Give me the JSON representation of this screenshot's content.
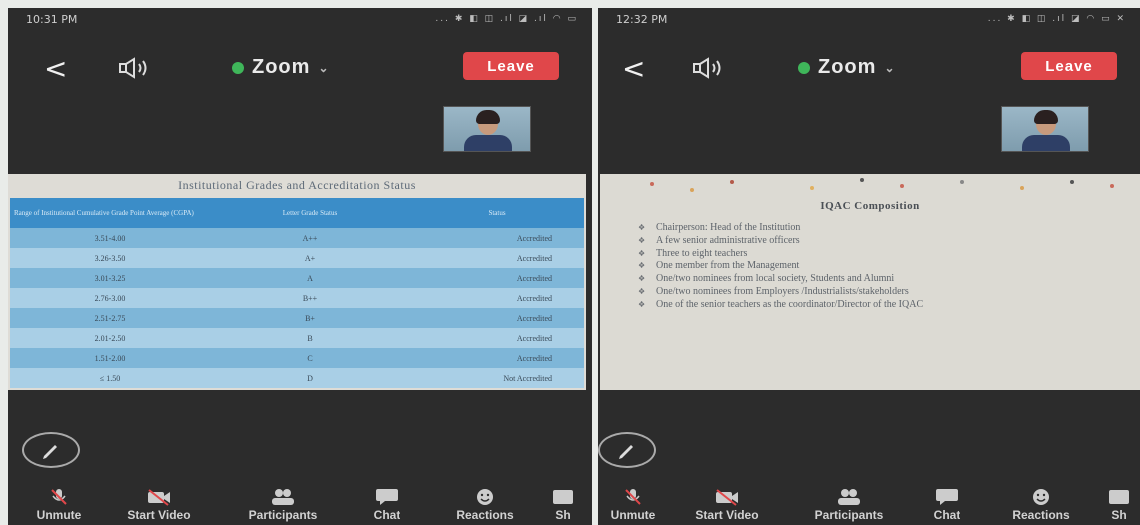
{
  "left": {
    "status_time": "10:31 PM",
    "status_icons": "... ✱ ◧ ◫ .ıl ◪ .ıl ◠ ▭",
    "back_glyph": "<",
    "app_title": "Zoom",
    "title_caret": "⌄",
    "leave_label": "Leave",
    "slide": {
      "title": "Institutional Grades and Accreditation Status",
      "headers": [
        "Range of Institutional Cumulative Grade Point Average (CGPA)",
        "Letter Grade Status",
        "Status"
      ],
      "rows": [
        [
          "3.51-4.00",
          "A++",
          "Accredited"
        ],
        [
          "3.26-3.50",
          "A+",
          "Accredited"
        ],
        [
          "3.01-3.25",
          "A",
          "Accredited"
        ],
        [
          "2.76-3.00",
          "B++",
          "Accredited"
        ],
        [
          "2.51-2.75",
          "B+",
          "Accredited"
        ],
        [
          "2.01-2.50",
          "B",
          "Accredited"
        ],
        [
          "1.51-2.00",
          "C",
          "Accredited"
        ],
        [
          "≤ 1.50",
          "D",
          "Not Accredited"
        ]
      ]
    },
    "toolbar": [
      {
        "icon": "mic-muted-icon",
        "label": "Unmute"
      },
      {
        "icon": "video-off-icon",
        "label": "Start Video"
      },
      {
        "icon": "participants-icon",
        "label": "Participants"
      },
      {
        "icon": "chat-icon",
        "label": "Chat"
      },
      {
        "icon": "reactions-icon",
        "label": "Reactions"
      },
      {
        "icon": "share-icon",
        "label": "Sh"
      }
    ]
  },
  "right": {
    "status_time": "12:32 PM",
    "status_icons": "... ✱ ◧ ◫ .ıl ◪ ◠ ▭ ✕",
    "back_glyph": "<",
    "app_title": "Zoom",
    "title_caret": "⌄",
    "leave_label": "Leave",
    "slide": {
      "title": "IQAC Composition",
      "items": [
        "Chairperson: Head of the Institution",
        "A few senior administrative officers",
        "Three to eight teachers",
        "One member from the Management",
        "One/two nominees from local society, Students and Alumni",
        "One/two nominees from Employers /Industrialists/stakeholders",
        "One of the senior teachers as the coordinator/Director of the IQAC"
      ]
    },
    "toolbar": [
      {
        "icon": "mic-muted-icon",
        "label": "Unmute"
      },
      {
        "icon": "video-off-icon",
        "label": "Start Video"
      },
      {
        "icon": "participants-icon",
        "label": "Participants"
      },
      {
        "icon": "chat-icon",
        "label": "Chat"
      },
      {
        "icon": "reactions-icon",
        "label": "Reactions"
      },
      {
        "icon": "share-icon",
        "label": "Sh"
      }
    ]
  },
  "colors": {
    "leave": "#e0474a",
    "secure": "#3fb65a",
    "table_header": "#3b8dc8"
  }
}
